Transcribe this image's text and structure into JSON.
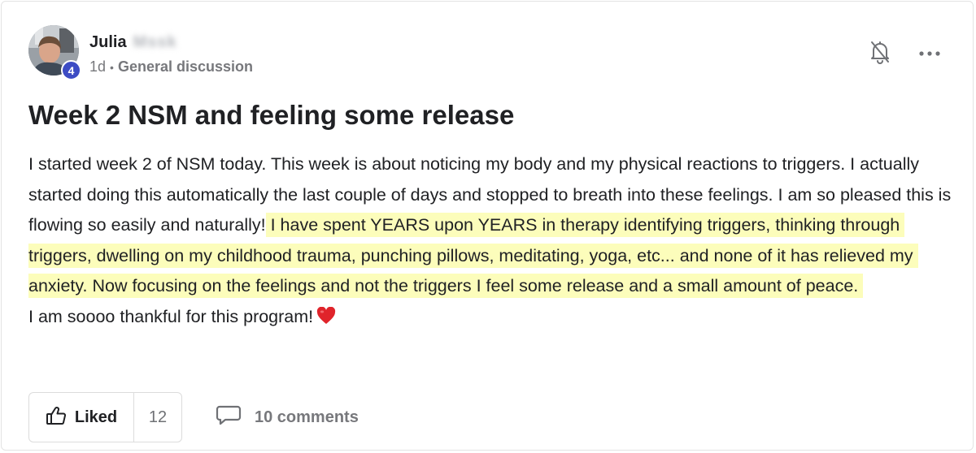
{
  "post": {
    "author": {
      "first_name": "Julia",
      "last_name_redacted": "Mssk",
      "level": "4",
      "avatar_icon": "user-photo"
    },
    "meta": {
      "time_ago": "1d",
      "separator": "•",
      "category": "General discussion"
    },
    "actions": {
      "bell_icon": "bell-off-icon",
      "more_icon": "more-horizontal-icon"
    },
    "title": "Week 2 NSM and feeling some release",
    "body": {
      "paragraph_1_plain": "I started week 2 of NSM today. This week is about noticing my body and my physical reactions to triggers. I actually started doing this automatically the last couple of days and stopped to breath into these feelings. I am so pleased this is flowing so easily and naturally!",
      "paragraph_1_highlight": " I have spent YEARS upon YEARS in therapy identifying triggers, thinking through triggers, dwelling on my childhood trauma, punching pillows, meditating, yoga, etc... and none of it has relieved my anxiety. Now focusing on the feelings and not the triggers I feel some release and a small amount of peace.",
      "paragraph_2": "I am soooo thankful for this program!",
      "emoji": "red-heart",
      "highlight_color": "#fcfdbb"
    },
    "footer": {
      "like_label": "Liked",
      "like_count": "12",
      "comments_label": "10 comments"
    }
  },
  "colors": {
    "badge": "#3d4cc4",
    "muted_text": "#77787c",
    "heart": "#e0242b"
  }
}
